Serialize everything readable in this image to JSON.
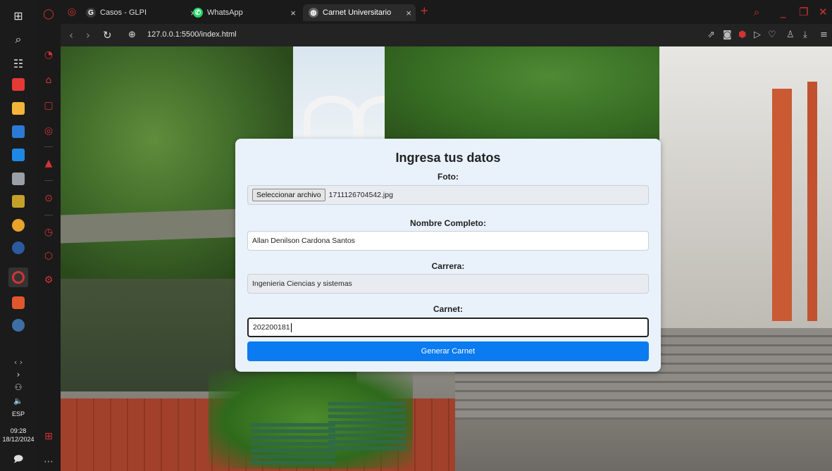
{
  "taskbar": {
    "language": "ESP",
    "time": "09:28",
    "date": "18/12/2024"
  },
  "tabs": [
    {
      "title": "Casos - GLPI",
      "favicon": "glpi-icon",
      "color": "#3a3a3a"
    },
    {
      "title": "WhatsApp",
      "favicon": "whatsapp-icon",
      "color": "#25d366"
    },
    {
      "title": "Carnet Universitario",
      "favicon": "globe-icon",
      "color": "#555555"
    }
  ],
  "address": {
    "url": "127.0.0.1:5500/index.html"
  },
  "form": {
    "title": "Ingresa tus datos",
    "photo_label": "Foto:",
    "file_button": "Seleccionar archivo",
    "file_name": "1711126704542.jpg",
    "name_label": "Nombre Completo:",
    "name_value": "Allan Denilson Cardona Santos",
    "career_label": "Carrera:",
    "career_value": "Ingenieria Ciencias y sistemas",
    "carnet_label": "Carnet:",
    "carnet_value": "202200181",
    "submit_label": "Generar Carnet"
  },
  "colors": {
    "accent": "#0a7bf0",
    "opera_red": "#d23434"
  }
}
